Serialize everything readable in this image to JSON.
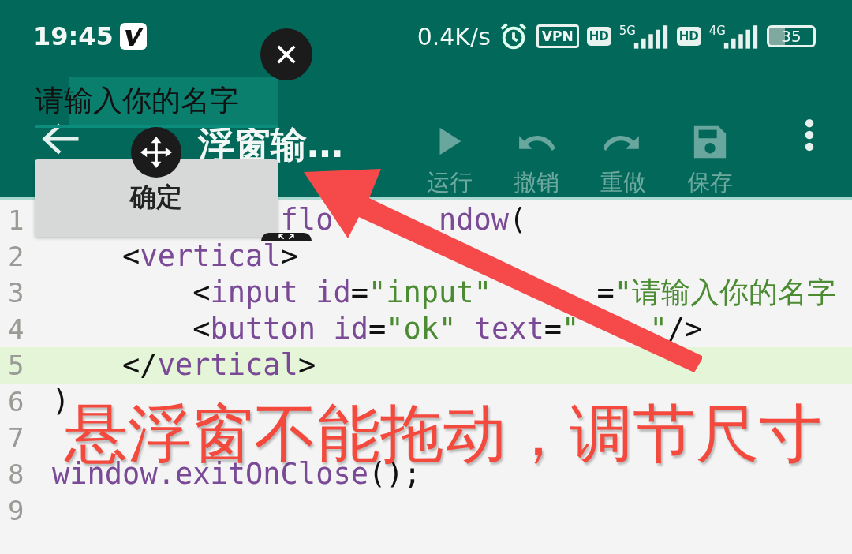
{
  "status_bar": {
    "time": "19:45",
    "net_speed": "0.4K/s",
    "vpn": "VPN",
    "networks": [
      {
        "hd": "HD",
        "type": "5G"
      },
      {
        "hd": "HD",
        "type": "4G"
      }
    ],
    "battery": "35"
  },
  "toolbar": {
    "title": "浮窗输…",
    "actions": [
      {
        "kind": "run",
        "label": "运行",
        "disabled": true
      },
      {
        "kind": "undo",
        "label": "撤销",
        "disabled": true
      },
      {
        "kind": "redo",
        "label": "重做",
        "disabled": true
      },
      {
        "kind": "save",
        "label": "保存",
        "disabled": true
      }
    ]
  },
  "editor": {
    "lines": [
      {
        "number": "1",
        "current": false,
        "tokens": [
          {
            "kind": "ident",
            "text": "             flo"
          },
          {
            "kind": "ident",
            "text": "      ndow"
          },
          {
            "kind": "plain",
            "text": "("
          }
        ]
      },
      {
        "number": "2",
        "current": false,
        "tokens": [
          {
            "kind": "plain",
            "text": "    <"
          },
          {
            "kind": "ident",
            "text": "vertical"
          },
          {
            "kind": "plain",
            "text": ">"
          }
        ]
      },
      {
        "number": "3",
        "current": false,
        "tokens": [
          {
            "kind": "plain",
            "text": "        <"
          },
          {
            "kind": "ident",
            "text": "input id"
          },
          {
            "kind": "plain",
            "text": "="
          },
          {
            "kind": "string",
            "text": "\"input\""
          },
          {
            "kind": "plain",
            "text": "      ="
          },
          {
            "kind": "string",
            "text": "\"请输入你的名字"
          }
        ]
      },
      {
        "number": "4",
        "current": false,
        "tokens": [
          {
            "kind": "plain",
            "text": "        <"
          },
          {
            "kind": "ident",
            "text": "button id"
          },
          {
            "kind": "plain",
            "text": "="
          },
          {
            "kind": "string",
            "text": "\"ok\""
          },
          {
            "kind": "ident",
            "text": " text"
          },
          {
            "kind": "plain",
            "text": "="
          },
          {
            "kind": "string",
            "text": "\""
          },
          {
            "kind": "string",
            "text": "    \""
          },
          {
            "kind": "plain",
            "text": "/>"
          }
        ]
      },
      {
        "number": "5",
        "current": true,
        "tokens": [
          {
            "kind": "plain",
            "text": "    </"
          },
          {
            "kind": "ident",
            "text": "vertical"
          },
          {
            "kind": "plain",
            "text": ">"
          }
        ]
      },
      {
        "number": "6",
        "current": false,
        "tokens": [
          {
            "kind": "plain",
            "text": ")"
          }
        ]
      },
      {
        "number": "7",
        "current": false
      },
      {
        "number": "8",
        "current": false,
        "tokens": [
          {
            "kind": "ident",
            "text": "window.exitOnClose"
          },
          {
            "kind": "plain",
            "text": "();"
          }
        ]
      },
      {
        "number": "9",
        "current": false
      }
    ]
  },
  "floaty": {
    "input": {
      "value": "请输入你的名字"
    },
    "button": "确定"
  },
  "annotation": {
    "text": "悬浮窗不能拖动，调节尺寸"
  }
}
